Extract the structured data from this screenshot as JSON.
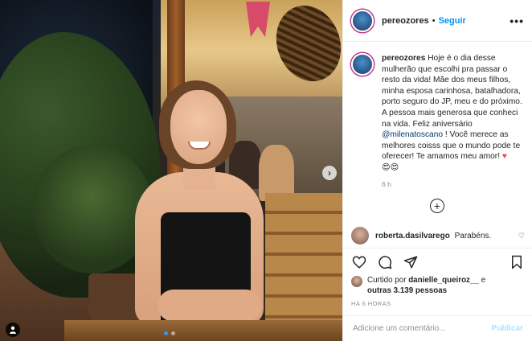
{
  "post": {
    "username": "pereozores",
    "follow_label": "Seguir",
    "separator": "•",
    "more_label": "•••",
    "caption": {
      "text_part1": "Hoje é o dia desse mulherão que escolhi pra passar o resto da vida! Mãe dos meus filhos, minha esposa carinhosa, batalhadora, porto seguro do JP, meu e do próximo. A pessoa mais generosa que conheci na vida. Feliz aniversário ",
      "mention": "@milenatoscano",
      "text_part2": " ! Você merece as melhores coisss que o mundo pode te oferecer! Te amamos meu amor! ",
      "heart": "♥",
      "emojis": "😍😍"
    },
    "caption_time": "6 h",
    "load_more_icon": "plus-circle-icon"
  },
  "comments": [
    {
      "username": "roberta.dasilvarego",
      "text": "Parabéns.",
      "like_icon": "♡"
    }
  ],
  "actions": {
    "like_icon": "heart-outline-icon",
    "comment_icon": "comment-icon",
    "share_icon": "paper-plane-icon",
    "save_icon": "bookmark-icon"
  },
  "likes": {
    "prefix": "Curtido por ",
    "user": "danielle_queiroz__",
    "middle": " e ",
    "others": "outras 3.139 pessoas"
  },
  "posted_ago": "HÁ 6 HORAS",
  "comment_box": {
    "placeholder": "Adicione um comentário...",
    "publish_label": "Publicar"
  },
  "carousel": {
    "next_label": "›",
    "slide_count": 2,
    "active_index": 0
  },
  "colors": {
    "accent": "#0095f6",
    "publish_disabled": "#b2dffc",
    "heart": "#ed4956",
    "mention": "#00376b",
    "muted": "#8e8e8e"
  }
}
